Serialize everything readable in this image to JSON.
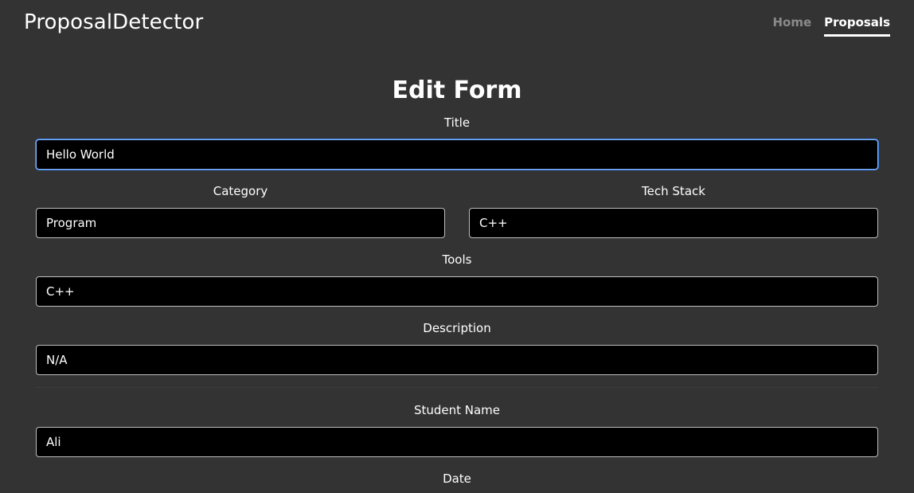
{
  "navbar": {
    "brand": "ProposalDetector",
    "links": [
      {
        "label": "Home",
        "active": false
      },
      {
        "label": "Proposals",
        "active": true
      }
    ]
  },
  "form": {
    "title": "Edit Form",
    "fields": {
      "title": {
        "label": "Title",
        "value": "Hello World"
      },
      "category": {
        "label": "Category",
        "value": "Program"
      },
      "tech_stack": {
        "label": "Tech Stack",
        "value": "C++"
      },
      "tools": {
        "label": "Tools",
        "value": "C++"
      },
      "description": {
        "label": "Description",
        "value": "N/A"
      },
      "student_name": {
        "label": "Student Name",
        "value": "Ali"
      },
      "date": {
        "label": "Date"
      }
    }
  },
  "colors": {
    "background": "#333333",
    "input_background": "#000000",
    "focus_border": "#86b7fe",
    "nav_inactive": "#8a8a8a"
  }
}
